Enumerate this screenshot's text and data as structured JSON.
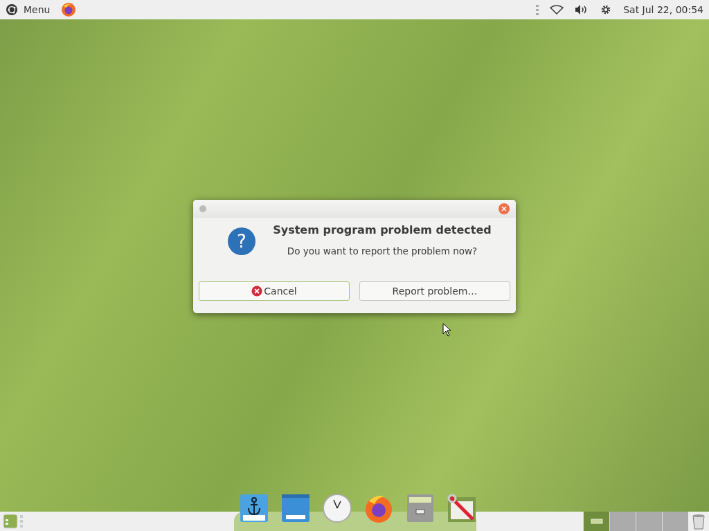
{
  "top_panel": {
    "menu_label": "Menu",
    "clock": "Sat Jul 22, 00:54"
  },
  "dialog": {
    "icon_glyph": "?",
    "title": "System program problem detected",
    "message": "Do you want to report the problem now?",
    "buttons": [
      {
        "label": "Cancel",
        "kind": "cancel"
      },
      {
        "label": "Report problem…",
        "kind": "plain"
      }
    ]
  },
  "dock": {
    "items": [
      {
        "kind": "anchor"
      },
      {
        "kind": "window"
      },
      {
        "kind": "clock"
      },
      {
        "kind": "browser"
      },
      {
        "kind": "cabinet"
      },
      {
        "kind": "tools"
      }
    ]
  },
  "workspaces": [
    {
      "selected": true
    },
    {
      "selected": false
    },
    {
      "selected": false
    },
    {
      "selected": false
    }
  ]
}
